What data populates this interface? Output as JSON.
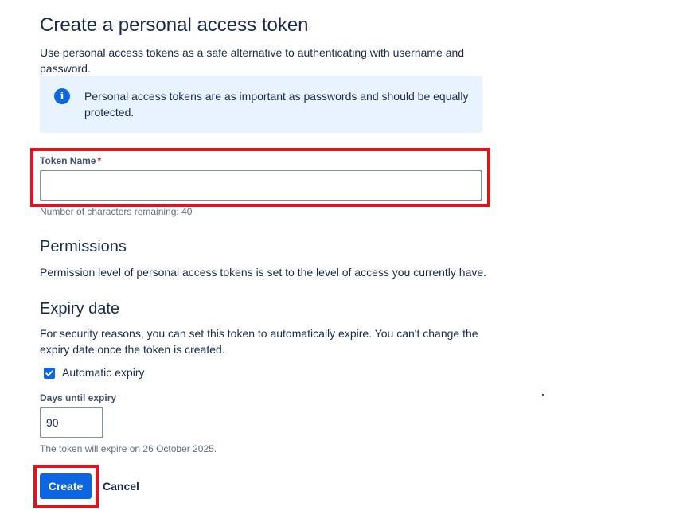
{
  "page": {
    "title": "Create a personal access token",
    "intro": "Use personal access tokens as a safe alternative to authenticating with username and password."
  },
  "info": {
    "icon": "info-icon",
    "icon_glyph": "i",
    "text": "Personal access tokens are as important as passwords and should be equally protected."
  },
  "token_field": {
    "label": "Token Name",
    "required_marker": "*",
    "value": "",
    "placeholder": "",
    "helper": "Number of characters remaining: 40"
  },
  "permissions": {
    "heading": "Permissions",
    "text": "Permission level of personal access tokens is set to the level of access you currently have."
  },
  "expiry": {
    "heading": "Expiry date",
    "text": "For security reasons, you can set this token to automatically expire. You can't change the expiry date once the token is created.",
    "checkbox_label": "Automatic expiry",
    "checkbox_checked": true,
    "days_label": "Days until expiry",
    "days_value": "90",
    "helper": "The token will expire on 26 October 2025."
  },
  "actions": {
    "create_label": "Create",
    "cancel_label": "Cancel"
  },
  "colors": {
    "primary": "#0c66e4",
    "highlight": "#e0141e",
    "info_background": "#e9f2ff",
    "text": "#172b4d"
  }
}
